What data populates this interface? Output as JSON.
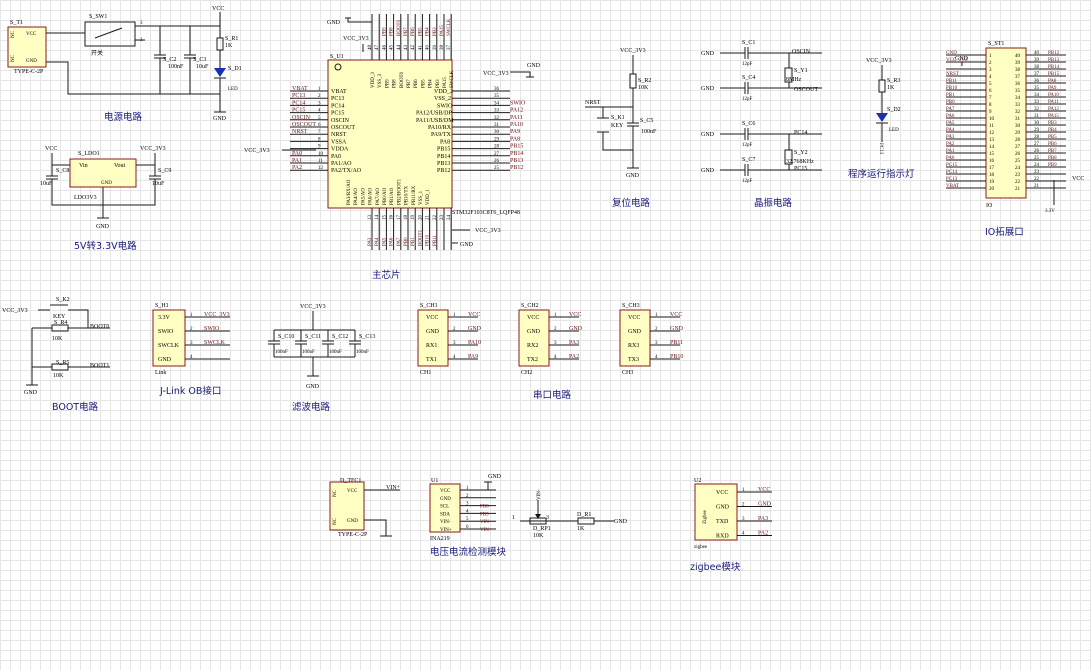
{
  "titles": {
    "power": "电源电路",
    "ldo": "5V转3.3V电路",
    "mcu": "主芯片",
    "reset": "复位电路",
    "crystal": "晶振电路",
    "led": "程序运行指示灯",
    "io": "IO拓展口",
    "boot": "BOOT电路",
    "jlink": "J-Link OB接口",
    "filter": "滤波电路",
    "uart": "串口电路",
    "ina": "电压电流检测模块",
    "zigbee": "zigbee模块"
  },
  "nets": {
    "vcc": "VCC",
    "vcc33": "VCC_3V3",
    "gnd": "GND",
    "vin_plus": "VIN+",
    "v33": "3.3V",
    "boot0": "BOOT0",
    "boot1": "BOOT1",
    "nrst": "NRST",
    "oscin": "OSCIN",
    "oscout": "OSCOUT",
    "pc14": "PC14",
    "pc15": "PC15"
  },
  "power": {
    "conn_ref": "S_T1",
    "conn_part": "TYPE-C-2P",
    "conn_pins": [
      "VCC",
      "GND"
    ],
    "nc": "NC",
    "sw_ref": "S_SW1",
    "sw_label": "开关",
    "c2": "S_C2",
    "c2v": "100nF",
    "c3": "S_C3",
    "c3v": "10uF",
    "r1": "S_R1",
    "r1v": "1K",
    "d1": "S_D1",
    "d1v": "LED"
  },
  "ldo": {
    "ref": "S_LDO1",
    "part": "LDO3V3",
    "vin": "Vin",
    "vout": "Vout",
    "gnd": "GND",
    "c8": "S_C8",
    "c8v": "10uF",
    "c9": "S_C9",
    "c9v": "10uF"
  },
  "mcu": {
    "ref": "S_U1",
    "part": "STM32F103C8T6_LQFP48",
    "left_nets": [
      "VBAT",
      "PC13",
      "PC14",
      "PC15",
      "OSCIN",
      "OSCOUT",
      "NRST",
      "",
      "",
      "PA0",
      "PA1",
      "PA2"
    ],
    "left_pins": [
      "VBAT",
      "PC13",
      "PC14",
      "PC15",
      "OSCIN",
      "OSCOUT",
      "NRST",
      "VSSA",
      "VDDA",
      "PA0",
      "PA1/AO",
      "PA2/TX/AO"
    ],
    "left_nums": [
      "1",
      "2",
      "3",
      "4",
      "5",
      "6",
      "7",
      "8",
      "9",
      "10",
      "11",
      "12"
    ],
    "right_pins": [
      "VDD_2",
      "VSS_2",
      "SWIO",
      "PA12/USB/DP",
      "PA11/USB/DM",
      "PA10/RX",
      "PA9/TX",
      "PA8",
      "PB15",
      "PB14",
      "PB13",
      "PB12"
    ],
    "right_nums": [
      "36",
      "35",
      "34",
      "33",
      "32",
      "31",
      "30",
      "29",
      "28",
      "27",
      "26",
      "25"
    ],
    "right_nets": [
      "",
      "",
      "SWIO",
      "PA12",
      "PA11",
      "PA10",
      "PA9",
      "PA8",
      "PB15",
      "PB14",
      "PB13",
      "PB12"
    ],
    "top_pins": [
      "VDD_3",
      "VSS_3",
      "PB9",
      "PB8",
      "BOOT0",
      "PB7",
      "PB6",
      "PB5",
      "PB4",
      "PB3",
      "PA15",
      "SWCLK"
    ],
    "top_nums": [
      "48",
      "47",
      "46",
      "45",
      "44",
      "43",
      "42",
      "41",
      "40",
      "39",
      "38",
      "37"
    ],
    "top_nets": [
      "",
      "",
      "PB9",
      "PB8",
      "BOOT0",
      "PB7",
      "PB6",
      "PB5",
      "PB4",
      "PB3",
      "PA15",
      "SWCLK"
    ],
    "bottom_pins": [
      "PA3/RX/AO",
      "PA4/AO",
      "PA5/AO",
      "PA6/AO",
      "PA7/AO",
      "PB0/AO",
      "PB1/AO",
      "PB2/BOOT1",
      "PB10/TX",
      "PB11/RX",
      "VSS_1",
      "VDD_1"
    ],
    "bottom_nums": [
      "13",
      "14",
      "15",
      "16",
      "17",
      "18",
      "19",
      "20",
      "21",
      "22",
      "23",
      "24"
    ],
    "bottom_nets": [
      "PA3",
      "PA4",
      "PA5",
      "PA6",
      "PA7",
      "PB0",
      "PB1",
      "BOOT1",
      "PB10",
      "PB11",
      "",
      ""
    ],
    "pin36": "36"
  },
  "reset": {
    "k1": "S_K1",
    "k1v": "KEY",
    "r2": "S_R2",
    "r2v": "10K",
    "c5": "S_C5",
    "c5v": "100nF"
  },
  "crystal": {
    "c1": "S_C1",
    "c4": "S_C4",
    "c6": "S_C6",
    "c7": "S_C7",
    "cv": "12pF",
    "y1": "S_Y1",
    "y1v": "8MHz",
    "y2": "S_Y2",
    "y2v": "32.768KHz"
  },
  "led": {
    "r3": "S_R3",
    "r3v": "1K",
    "d2": "S_D2",
    "d2v": "LED",
    "net": "PC13"
  },
  "io": {
    "ref": "S_ST1",
    "left_nets": [
      "GND",
      "VCC_3V3",
      "",
      "NRST",
      "PB11",
      "PB10",
      "PB1",
      "PB0",
      "PA7",
      "PA6",
      "PA5",
      "PA4",
      "PA3",
      "PA2",
      "PA1",
      "PA0",
      "PC15",
      "PC14",
      "PC13",
      "VBAT"
    ],
    "left_nums": [
      "1",
      "2",
      "3",
      "4",
      "5",
      "6",
      "7",
      "8",
      "9",
      "10",
      "11",
      "12",
      "13",
      "14",
      "15",
      "16",
      "17",
      "18",
      "19",
      "20"
    ],
    "right_nums": [
      "40",
      "39",
      "38",
      "37",
      "36",
      "35",
      "34",
      "33",
      "32",
      "31",
      "30",
      "29",
      "28",
      "27",
      "26",
      "25",
      "24",
      "23",
      "22",
      "21"
    ],
    "right_nets": [
      "PB12",
      "PB13",
      "PB14",
      "PB15",
      "PA8",
      "PA9",
      "PA10",
      "PA11",
      "PA12",
      "PA15",
      "PB3",
      "PB4",
      "PB5",
      "PB6",
      "PB7",
      "PB8",
      "PB9",
      "",
      "",
      ""
    ],
    "vcc": "VCC",
    "v33": "3.3V"
  },
  "boot": {
    "k2": "S_K2",
    "k2v": "KEY",
    "r4": "S_R4",
    "r4v": "10K",
    "r5": "S_R5",
    "r5v": "10K"
  },
  "jlink": {
    "ref": "S_H1",
    "part": "Link",
    "pins": [
      "3.3V",
      "SWIO",
      "SWCLK",
      "GND"
    ],
    "nums": [
      "1",
      "2",
      "3",
      "4"
    ],
    "nets": [
      "VCC_3V3",
      "SWIO",
      "SWCLK",
      ""
    ]
  },
  "filter": {
    "caps": [
      "S_C10",
      "S_C11",
      "S_C12",
      "S_C13"
    ],
    "cv": "100nF"
  },
  "uart": [
    {
      "ref": "S_CH1",
      "part": "CH1",
      "pins": [
        "VCC",
        "GND",
        "RX1",
        "TX1"
      ],
      "nets": [
        "VCC",
        "GND",
        "PA10",
        "PA9"
      ]
    },
    {
      "ref": "S_CH2",
      "part": "CH2",
      "pins": [
        "VCC",
        "GND",
        "RX2",
        "TX2"
      ],
      "nets": [
        "VCC",
        "GND",
        "PA3",
        "PA2"
      ]
    },
    {
      "ref": "S_CH3",
      "part": "CH3",
      "pins": [
        "VCC",
        "GND",
        "RX3",
        "TX3"
      ],
      "nets": [
        "VCC",
        "GND",
        "PB11",
        "PB10"
      ]
    }
  ],
  "tfc": {
    "ref": "D_TFC1",
    "part": "TYPE-C-2P",
    "pins": [
      "VCC",
      "GND"
    ],
    "nc": "NC",
    "net": "VIN+"
  },
  "ina": {
    "ref": "U1",
    "part": "INA219",
    "pins": [
      "VCC",
      "GND",
      "SCL",
      "SDA",
      "VIN-",
      "VIN+"
    ],
    "nets": [
      "",
      "",
      "PB8",
      "PB9",
      "VIN-",
      "VIN+"
    ]
  },
  "probe": {
    "rp": "D_RP1",
    "rpv": "10K",
    "r1": "D_R1",
    "r1v": "1K",
    "net": "VIN-"
  },
  "zigbee": {
    "ref": "U2",
    "name": "Zigbee",
    "part": "zigbee",
    "pins": [
      "VCC",
      "GND",
      "TXD",
      "RXD"
    ],
    "nets": [
      "VCC",
      "GND",
      "PA3",
      "PA2"
    ]
  }
}
